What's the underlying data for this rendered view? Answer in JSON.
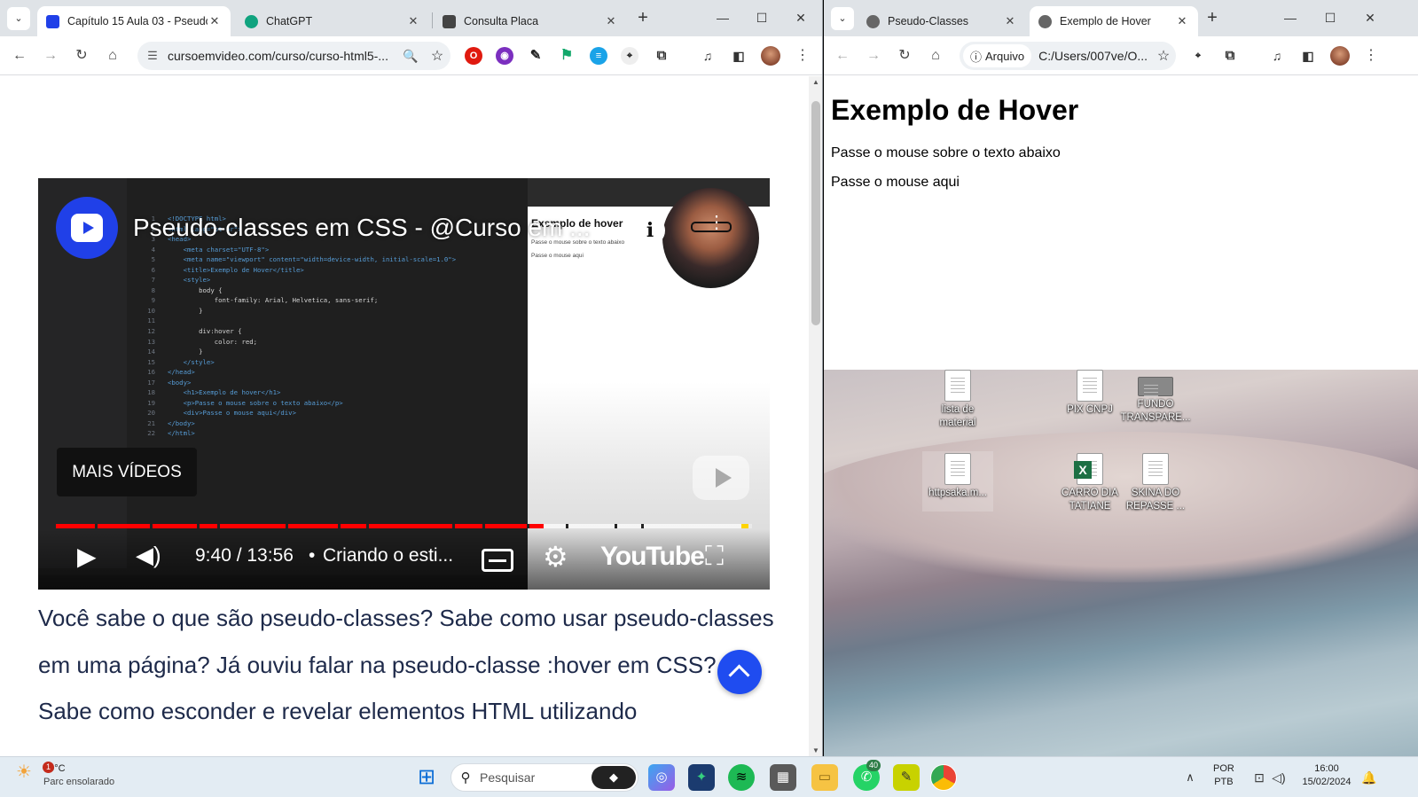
{
  "left_browser": {
    "tabs": [
      {
        "title": "Capítulo 15 Aula 03 - Pseudo",
        "active": true
      },
      {
        "title": "ChatGPT",
        "active": false
      },
      {
        "title": "Consulta Placa",
        "active": false
      }
    ],
    "url": "cursoemvideo.com/curso/curso-html5-...",
    "video": {
      "title": "Pseudo-classes em CSS - @Curso em ...",
      "more_videos": "MAIS VÍDEOS",
      "time": "9:40 / 13:56",
      "separator": "•",
      "chapter": "Criando o esti...",
      "brand": "YouTube",
      "progress_fraction": 0.7,
      "code_lines": [
        {
          "n": "1",
          "code": "<!DOCTYPE html>"
        },
        {
          "n": "2",
          "code": "<html lang=\"pt-br\">"
        },
        {
          "n": "3",
          "code": "<head>"
        },
        {
          "n": "4",
          "code": "    <meta charset=\"UTF-8\">"
        },
        {
          "n": "5",
          "code": "    <meta name=\"viewport\" content=\"width=device-width, initial-scale=1.0\">"
        },
        {
          "n": "6",
          "code": "    <title>Exemplo de Hover</title>"
        },
        {
          "n": "7",
          "code": "    <style>"
        },
        {
          "n": "8",
          "code": "        body {"
        },
        {
          "n": "9",
          "code": "            font-family: Arial, Helvetica, sans-serif;"
        },
        {
          "n": "10",
          "code": "        }"
        },
        {
          "n": "11",
          "code": ""
        },
        {
          "n": "12",
          "code": "        div:hover {"
        },
        {
          "n": "13",
          "code": "            color: red;"
        },
        {
          "n": "14",
          "code": "        }"
        },
        {
          "n": "15",
          "code": "    </style>"
        },
        {
          "n": "16",
          "code": "</head>"
        },
        {
          "n": "17",
          "code": "<body>"
        },
        {
          "n": "18",
          "code": "    <h1>Exemplo de hover</h1>"
        },
        {
          "n": "19",
          "code": "    <p>Passe o mouse sobre o texto abaixo</p>"
        },
        {
          "n": "20",
          "code": "    <div>Passe o mouse aqui</div>"
        },
        {
          "n": "21",
          "code": "</body>"
        },
        {
          "n": "22",
          "code": "</html>"
        }
      ],
      "inner_browser": {
        "h1": "Exemplo de hover",
        "p": "Passe o mouse sobre o texto abaixo",
        "div": "Passe o mouse aqui"
      }
    },
    "article_text": "Você sabe o que são pseudo-classes? Sabe como usar pseudo-classes em uma página? Já ouviu falar na pseudo-classe :hover em CSS? Sabe como esconder e revelar elementos HTML utilizando"
  },
  "right_browser": {
    "tabs": [
      {
        "title": "Pseudo-Classes",
        "active": false
      },
      {
        "title": "Exemplo de Hover",
        "active": true
      }
    ],
    "url_chip": "Arquivo",
    "url": "C:/Users/007ve/O...",
    "page": {
      "heading": "Exemplo de Hover",
      "paragraph": "Passe o mouse sobre o texto abaixo",
      "div_text": "Passe o mouse aqui"
    }
  },
  "desktop_icons": [
    {
      "label": "lista de material",
      "type": "doc"
    },
    {
      "label": "PIX CNPJ",
      "type": "doc"
    },
    {
      "label": "FUNDO TRANSPARE...",
      "type": "img"
    },
    {
      "label": "httpsaka.m...",
      "type": "doc"
    },
    {
      "label": "CARRO DIA TATIANE",
      "type": "excel"
    },
    {
      "label": "SKINA DO REPASSE ...",
      "type": "doc"
    }
  ],
  "taskbar": {
    "weather_temp": "30°C",
    "weather_desc": "Parc ensolarado",
    "weather_badge": "1",
    "search_placeholder": "Pesquisar",
    "whatsapp_badge": "40",
    "lang": "POR",
    "layout": "PTB",
    "time": "16:00",
    "date": "15/02/2024"
  },
  "colors": {
    "accent_blue": "#1f4cf0",
    "yt_red": "#ff0000",
    "article_text": "#1e2a4a"
  }
}
